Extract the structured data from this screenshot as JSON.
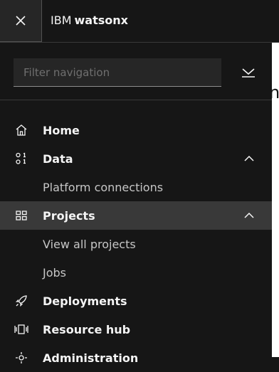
{
  "header": {
    "brand_company": "IBM",
    "brand_product": "watsonx",
    "close_icon": "close-icon"
  },
  "filter": {
    "placeholder": "Filter navigation",
    "value": ""
  },
  "right_glyph": "n",
  "nav": {
    "home": "Home",
    "data": "Data",
    "platform_connections": "Platform connections",
    "projects": "Projects",
    "view_all_projects": "View all projects",
    "jobs": "Jobs",
    "deployments": "Deployments",
    "resource_hub": "Resource hub",
    "administration": "Administration"
  },
  "colors": {
    "background": "#161616",
    "active_item": "#393939",
    "text": "#f4f4f4"
  }
}
